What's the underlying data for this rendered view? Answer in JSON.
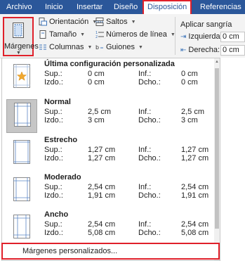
{
  "tabs": [
    {
      "label": "Archivo",
      "active": false
    },
    {
      "label": "Inicio",
      "active": false
    },
    {
      "label": "Insertar",
      "active": false
    },
    {
      "label": "Diseño",
      "active": false
    },
    {
      "label": "Disposición",
      "active": true
    },
    {
      "label": "Referencias",
      "active": false
    }
  ],
  "ribbon": {
    "margins_label": "Márgenes",
    "orientation_label": "Orientación",
    "size_label": "Tamaño",
    "columns_label": "Columnas",
    "breaks_label": "Saltos",
    "line_numbers_label": "Números de línea",
    "hyphenation_label": "Guiones",
    "indent_title": "Aplicar sangría",
    "indent_left_label": "Izquierda:",
    "indent_left_value": "0 cm",
    "indent_right_label": "Derecha:",
    "indent_right_value": "0 cm"
  },
  "labels": {
    "top": "Sup.:",
    "left": "Izdo.:",
    "bottom": "Inf.:",
    "right": "Dcho.:"
  },
  "options": [
    {
      "name": "Última configuración personalizada",
      "top": "0 cm",
      "bottom": "0 cm",
      "left": "0 cm",
      "right": "0 cm",
      "icon": "star-page-icon"
    },
    {
      "name": "Normal",
      "top": "2,5 cm",
      "bottom": "2,5 cm",
      "left": "3 cm",
      "right": "3 cm",
      "icon": "page-icon"
    },
    {
      "name": "Estrecho",
      "top": "1,27 cm",
      "bottom": "1,27 cm",
      "left": "1,27 cm",
      "right": "1,27 cm",
      "icon": "page-icon"
    },
    {
      "name": "Moderado",
      "top": "2,54 cm",
      "bottom": "2,54 cm",
      "left": "1,91 cm",
      "right": "1,91 cm",
      "icon": "page-icon"
    },
    {
      "name": "Ancho",
      "top": "2,54 cm",
      "bottom": "2,54 cm",
      "left": "5,08 cm",
      "right": "5,08 cm",
      "icon": "page-icon"
    }
  ],
  "custom_margins_label": "Márgenes personalizados...",
  "colors": {
    "ribbon_blue": "#2b579a",
    "highlight_red": "#e0202a",
    "selected_bg": "#c6c6c6"
  }
}
